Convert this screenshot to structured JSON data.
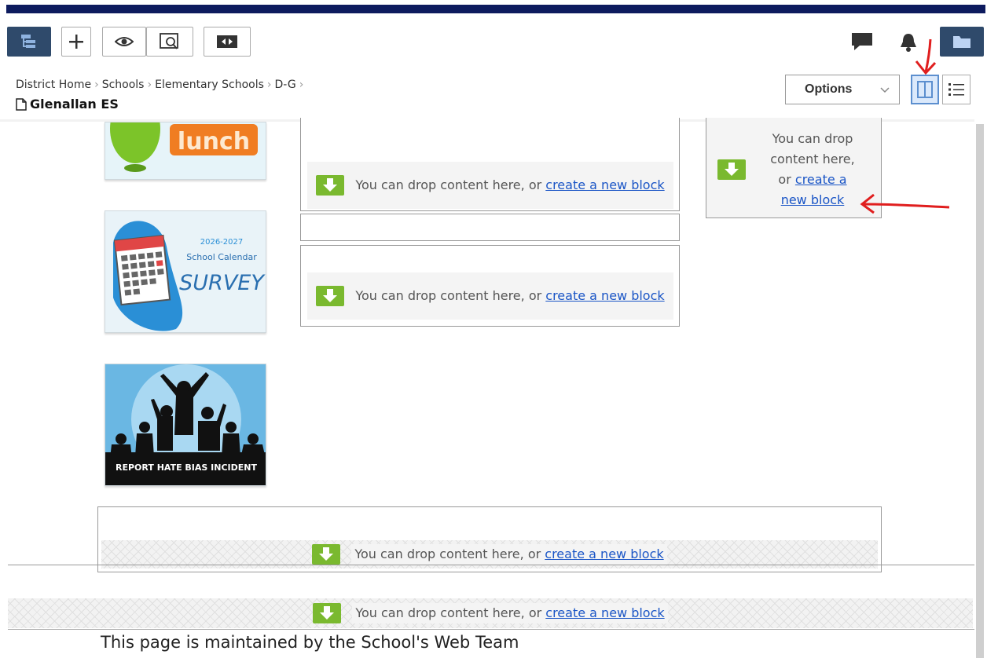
{
  "toolbar": {
    "buttons": [
      "site-tree",
      "add",
      "view",
      "preview",
      "swap"
    ],
    "accent": "#2f4a6b"
  },
  "breadcrumb": {
    "items": [
      "District Home",
      "Schools",
      "Elementary Schools",
      "D-G"
    ]
  },
  "page": {
    "title": "Glenallan ES"
  },
  "options": {
    "label": "Options"
  },
  "tiles": {
    "lunch": {
      "text": "lunch"
    },
    "calendar": {
      "year": "2026-2027",
      "line1": "School Calendar",
      "line2": "SURVEY"
    },
    "hate": {
      "text": "REPORT HATE BIAS INCIDENT"
    }
  },
  "drops": {
    "prefix": "You can drop content here, or",
    "link": "create a new block",
    "right_a": "You can drop",
    "right_b": "content here,",
    "right_c": "or",
    "right_link_a": "create a",
    "right_link_b": "new block"
  },
  "footer": {
    "text": "This page is maintained by the School's Web Team"
  },
  "colors": {
    "drop_icon": "#7ab92f",
    "link": "#1a55c6",
    "annotation": "#e01e1e"
  }
}
